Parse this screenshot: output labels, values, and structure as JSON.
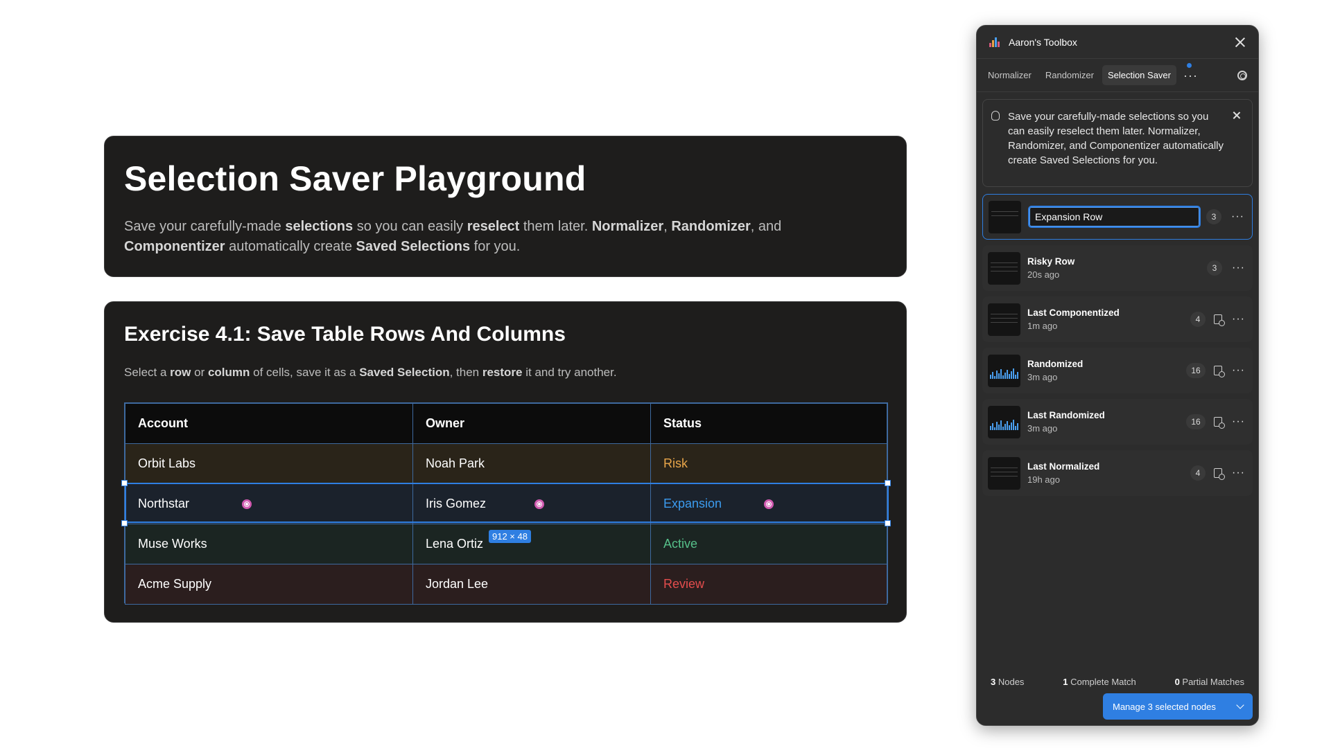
{
  "hero": {
    "title": "Selection Saver Playground",
    "desc": [
      {
        "t": "Save your carefully-made "
      },
      {
        "b": "selections"
      },
      {
        "t": " so you can easily "
      },
      {
        "b": "reselect"
      },
      {
        "t": " them later. "
      },
      {
        "b": "Normalizer"
      },
      {
        "t": ", "
      },
      {
        "b": "Randomizer"
      },
      {
        "t": ", and "
      },
      {
        "b": "Componentizer"
      },
      {
        "t": " automatically create "
      },
      {
        "b": "Saved Selections"
      },
      {
        "t": " for you."
      }
    ]
  },
  "exercise": {
    "title": "Exercise 4.1: Save Table Rows And Columns",
    "desc": [
      {
        "t": "Select a "
      },
      {
        "b": "row"
      },
      {
        "t": " or "
      },
      {
        "b": "column"
      },
      {
        "t": " of cells, save it as a "
      },
      {
        "b": "Saved Selection"
      },
      {
        "t": ", then "
      },
      {
        "b": "restore"
      },
      {
        "t": " it and try another."
      }
    ],
    "table": {
      "headers": [
        "Account",
        "Owner",
        "Status"
      ],
      "rows": [
        {
          "account": "Orbit Labs",
          "owner": "Noah Park",
          "status": "Risk"
        },
        {
          "account": "Northstar",
          "owner": "Iris Gomez",
          "status": "Expansion"
        },
        {
          "account": "Muse Works",
          "owner": "Lena Ortiz",
          "status": "Active"
        },
        {
          "account": "Acme Supply",
          "owner": "Jordan Lee",
          "status": "Review"
        }
      ]
    },
    "selection_size": "912 × 48"
  },
  "panel": {
    "title": "Aaron's Toolbox",
    "tabs": [
      "Normalizer",
      "Randomizer",
      "Selection Saver"
    ],
    "active_tab": "Selection Saver",
    "tip": "Save your carefully-made selections so you can easily reselect them later. Normalizer, Randomizer, and Componentizer automatically create Saved Selections for you.",
    "editing": {
      "value": "Expansion Row",
      "count": "3"
    },
    "selections": [
      {
        "name": "Risky Row",
        "time": "20s ago",
        "count": "3",
        "has_doc": false,
        "thumb": "lines"
      },
      {
        "name": "Last Componentized",
        "time": "1m ago",
        "count": "4",
        "has_doc": true,
        "thumb": "lines"
      },
      {
        "name": "Randomized",
        "time": "3m ago",
        "count": "16",
        "has_doc": true,
        "thumb": "bars"
      },
      {
        "name": "Last Randomized",
        "time": "3m ago",
        "count": "16",
        "has_doc": true,
        "thumb": "bars"
      },
      {
        "name": "Last Normalized",
        "time": "19h ago",
        "count": "4",
        "has_doc": true,
        "thumb": "lines"
      }
    ],
    "stats": {
      "nodes_count": "3",
      "nodes_label": " Nodes",
      "complete_count": "1",
      "complete_label": " Complete Match",
      "partial_count": "0",
      "partial_label": " Partial Matches"
    },
    "manage_button": "Manage 3 selected nodes"
  },
  "colors": {
    "accent": "#2f7fe2",
    "risk": "#e9a64a",
    "expansion": "#3c9cf0",
    "active": "#56c08a",
    "review": "#e44d4d"
  }
}
